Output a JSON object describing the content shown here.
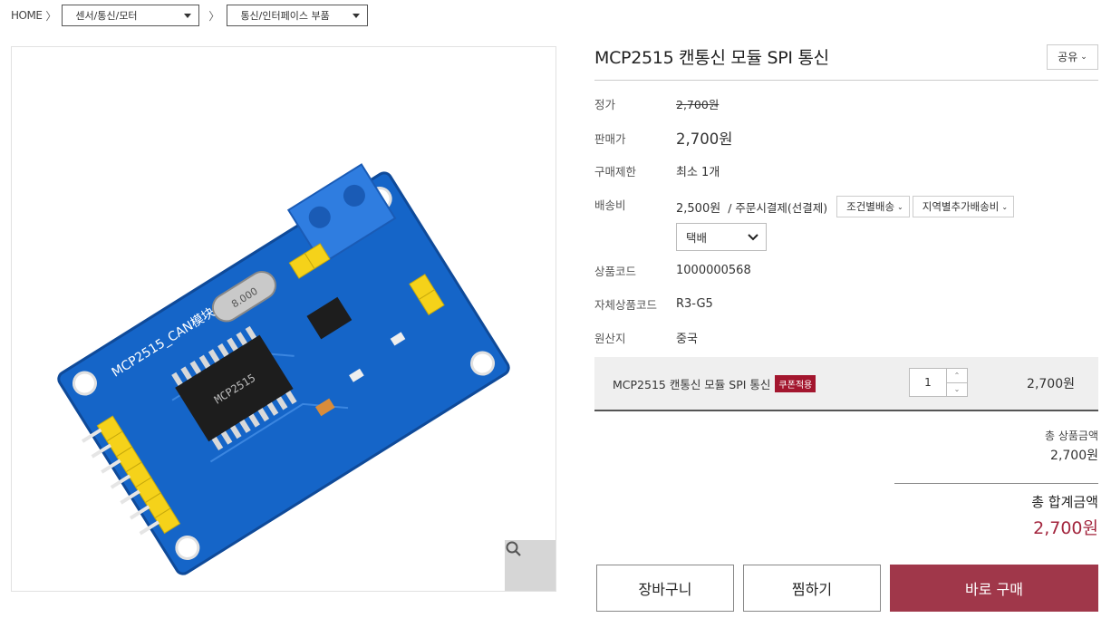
{
  "breadcrumb": {
    "home": "HOME",
    "category1": "센서/통신/모터",
    "category2": "통신/인터페이스 부품"
  },
  "product": {
    "title": "MCP2515 캔통신 모듈 SPI 통신",
    "share_label": "공유",
    "list_price_label": "정가",
    "list_price": "2,700원",
    "sale_price_label": "판매가",
    "sale_price": "2,700원",
    "purchase_limit_label": "구매제한",
    "purchase_limit": "최소 1개",
    "shipping_label": "배송비",
    "shipping_fee": "2,500원",
    "shipping_method_text": "/ 주문시결제(선결제)",
    "shipping_btn1": "조건별배송",
    "shipping_btn2": "지역별추가배송비",
    "delivery_select": "택배",
    "code_label": "상품코드",
    "code": "1000000568",
    "own_code_label": "자체상품코드",
    "own_code": "R3-G5",
    "origin_label": "원산지",
    "origin": "중국"
  },
  "option": {
    "name": "MCP2515 캔통신 모듈 SPI 통신",
    "coupon_badge": "쿠폰적용",
    "quantity": "1",
    "price": "2,700원"
  },
  "totals": {
    "product_total_label": "총 상품금액",
    "product_total": "2,700원",
    "grand_total_label": "총 합계금액",
    "grand_total": "2,700원"
  },
  "actions": {
    "cart": "장바구니",
    "wishlist": "찜하기",
    "buy_now": "바로 구매"
  },
  "image": {
    "board_text": "MCP2515_CAN模块",
    "chip_text": "MCP2515",
    "crystal_text": "8.000"
  },
  "colors": {
    "accent": "#a0374a",
    "price_red": "#a3263e",
    "badge": "#a3162e",
    "pcb_blue": "#1565c8"
  }
}
